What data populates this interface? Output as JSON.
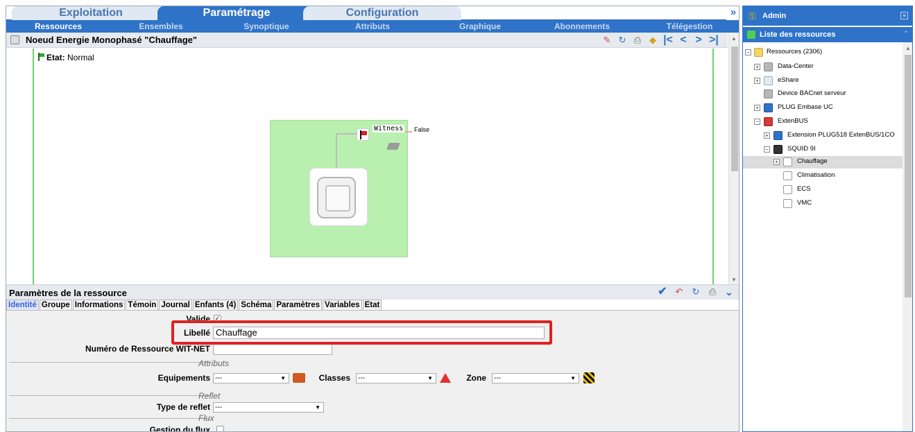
{
  "main_tabs": [
    "Exploitation",
    "Paramétrage",
    "Configuration"
  ],
  "active_main_tab": "Paramétrage",
  "sub_tabs": [
    "Ressources",
    "Ensembles",
    "Synoptique",
    "Attributs",
    "Graphique",
    "Abonnements",
    "Télégestion"
  ],
  "active_sub_tab": "Ressources",
  "expand_glyph": "»",
  "resource_title": "Noeud Energie Monophasé \"Chauffage\"",
  "nav_icons": [
    "edit-icon",
    "refresh-icon",
    "print-icon",
    "tag-icon",
    "first-icon",
    "prev-icon",
    "next-icon",
    "last-icon"
  ],
  "synoptic": {
    "etat_label": "Etat:",
    "etat_value": "Normal",
    "witness_label": "Witness",
    "witness_value": "False"
  },
  "params": {
    "title": "Paramètres de la ressource",
    "tabs": [
      "Identité",
      "Groupe",
      "Informations",
      "Témoin",
      "Journal",
      "Enfants (4)",
      "Schéma",
      "Paramètres",
      "Variables",
      "Etat"
    ],
    "active_tab": "Identité",
    "valide_label": "Valide",
    "valide_checked": true,
    "libelle_label": "Libellé",
    "libelle_value": "Chauffage",
    "numero_label": "Numéro de Ressource WIT-NET",
    "numero_value": "",
    "section_attributs": "Attributs",
    "equipements_label": "Equipements",
    "equipements_value": "---",
    "classes_label": "Classes",
    "classes_value": "---",
    "zone_label": "Zone",
    "zone_value": "---",
    "section_reflet": "Reflet",
    "type_reflet_label": "Type de reflet",
    "type_reflet_value": "---",
    "section_flux": "Flux",
    "gestion_flux_label": "Gestion du flux",
    "gestion_flux_checked": false
  },
  "right_panel": {
    "user": "Admin",
    "list_title": "Liste des ressources",
    "tree": [
      {
        "label": "Ressources (2306)",
        "level": 0,
        "expander": "−",
        "icon": "folder"
      },
      {
        "label": "Data-Center",
        "level": 1,
        "expander": "+",
        "icon": "server"
      },
      {
        "label": "eShare",
        "level": 1,
        "expander": "+",
        "icon": "share"
      },
      {
        "label": "Device BACnet serveur",
        "level": 1,
        "expander": "",
        "icon": "server"
      },
      {
        "label": "PLUG Embase UC",
        "level": 1,
        "expander": "+",
        "icon": "plug"
      },
      {
        "label": "ExtenBUS",
        "level": 1,
        "expander": "−",
        "icon": "bus"
      },
      {
        "label": "Extension PLUG518 ExtenBUS/1CO",
        "level": 2,
        "expander": "+",
        "icon": "plug"
      },
      {
        "label": "SQUID 9I",
        "level": 2,
        "expander": "−",
        "icon": "squid"
      },
      {
        "label": "Chauffage",
        "level": 3,
        "expander": "+",
        "icon": "node",
        "selected": true
      },
      {
        "label": "Climatisation",
        "level": 3,
        "expander": "",
        "icon": "node"
      },
      {
        "label": "ECS",
        "level": 3,
        "expander": "",
        "icon": "node"
      },
      {
        "label": "VMC",
        "level": 3,
        "expander": "",
        "icon": "node"
      }
    ]
  }
}
